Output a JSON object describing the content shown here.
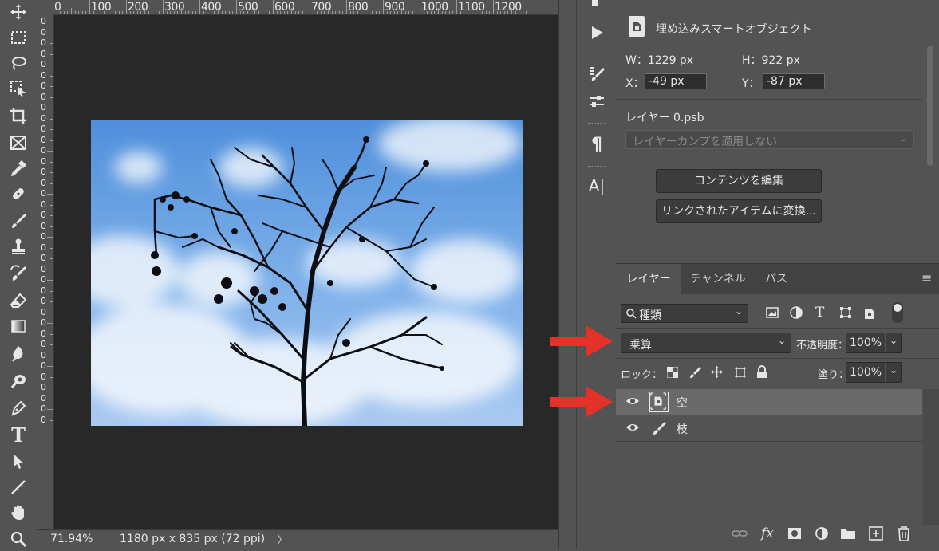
{
  "colors": {
    "accent_red": "#e4322b",
    "panel": "#535353",
    "canvas": "#282828",
    "selected_layer": "#6a6a6a"
  },
  "ruler": {
    "top_labels": [
      "0",
      "100",
      "200",
      "300",
      "400",
      "500",
      "600",
      "700",
      "800",
      "900",
      "1000",
      "1100",
      "1200"
    ],
    "left_labels": [
      "0",
      "0",
      "0",
      "0",
      "0",
      "0",
      "0",
      "0",
      "0",
      "0",
      "0",
      "0",
      "0",
      "0",
      "0",
      "0",
      "0",
      "0",
      "0",
      "0",
      "0",
      "0",
      "0",
      "0",
      "0",
      "0",
      "0",
      "0",
      "0",
      "0",
      "0",
      "0",
      "0",
      "0",
      "0",
      "0",
      "0",
      "0"
    ]
  },
  "toolbar": {
    "tools": [
      "move-icon",
      "marquee-icon",
      "lasso-icon",
      "object-select-icon",
      "crop-icon",
      "frame-icon",
      "eyedropper-icon",
      "healing-icon",
      "brush-icon",
      "stamp-icon",
      "history-brush-icon",
      "eraser-icon",
      "gradient-icon",
      "blur-icon",
      "dodge-icon",
      "pen-icon",
      "type-icon",
      "path-select-icon",
      "line-icon",
      "hand-icon",
      "zoom-icon"
    ],
    "type_tool_label": "T"
  },
  "status": {
    "zoom": "71.94%",
    "doc_size": "1180 px x 835 px (72 ppi)",
    "arrow": "〉"
  },
  "properties": {
    "object_type": "埋め込みスマートオブジェクト",
    "w_label": "W：1229 px",
    "h_label": "H：922 px",
    "x_label": "X：",
    "x_value": "-49 px",
    "y_label": "Y：",
    "y_value": "-87 px",
    "layer_file": "レイヤー 0.psb",
    "comp_placeholder": "レイヤーカンプを適用しない",
    "edit_contents_button": "コンテンツを編集",
    "convert_linked_button": "リンクされたアイテムに変換..."
  },
  "layers_panel": {
    "tabs": [
      "レイヤー",
      "チャンネル",
      "パス"
    ],
    "filter_label": "種類",
    "blend_mode": "乗算",
    "opacity_label": "不透明度：",
    "opacity_value": "100%",
    "lock_label": "ロック：",
    "fill_label": "塗り：",
    "fill_value": "100%",
    "layers": [
      {
        "name": "空",
        "selected": true
      },
      {
        "name": "枝",
        "selected": false
      }
    ]
  },
  "icon_column": {
    "glyph_type": "¶",
    "glyph_char": "A|"
  }
}
